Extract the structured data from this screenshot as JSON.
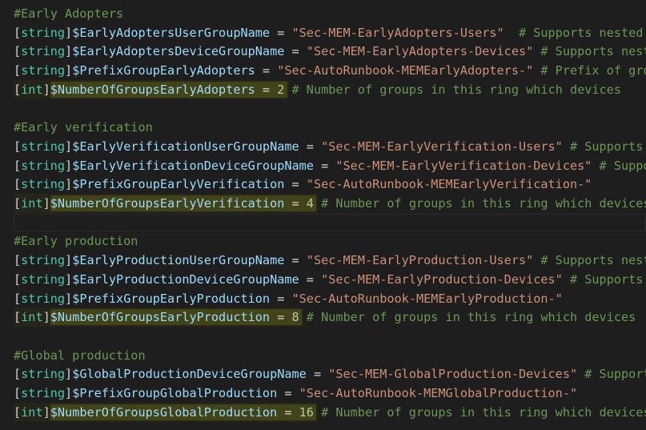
{
  "editor": {
    "colors": {
      "background": "#1e1e1e",
      "comment": "#6a9955",
      "type": "#4ec9b0",
      "variable": "#9cdcfe",
      "string": "#ce9178",
      "number": "#b5cea8"
    },
    "lines": [
      {
        "kind": "comment",
        "text": "#Early Adopters"
      },
      {
        "kind": "assign",
        "type": "string",
        "var": "$EarlyAdoptersUserGroupName",
        "op": " = ",
        "value": "\"Sec-MEM-EarlyAdopters-Users\"",
        "trail": "  # Supports nested groups"
      },
      {
        "kind": "assign",
        "type": "string",
        "var": "$EarlyAdoptersDeviceGroupName",
        "op": " = ",
        "value": "\"Sec-MEM-EarlyAdopters-Devices\"",
        "trail": " # Supports nested groups"
      },
      {
        "kind": "assign",
        "type": "string",
        "var": "$PrefixGroupEarlyAdopters",
        "op": " = ",
        "value": "\"Sec-AutoRunbook-MEMEarlyAdopters-\"",
        "trail": " # Prefix of groups"
      },
      {
        "kind": "assign",
        "type": "int",
        "var": "$NumberOfGroupsEarlyAdopters",
        "op": " = ",
        "value": "2",
        "trail": " # Number of groups in this ring which devices",
        "highlight": true
      },
      {
        "kind": "blank",
        "text": ""
      },
      {
        "kind": "comment",
        "text": "#Early verification"
      },
      {
        "kind": "assign",
        "type": "string",
        "var": "$EarlyVerificationUserGroupName",
        "op": " = ",
        "value": "\"Sec-MEM-EarlyVerification-Users\"",
        "trail": " # Supports nested groups"
      },
      {
        "kind": "assign",
        "type": "string",
        "var": "$EarlyVerificationDeviceGroupName",
        "op": " = ",
        "value": "\"Sec-MEM-EarlyVerification-Devices\"",
        "trail": " # Supports nested groups"
      },
      {
        "kind": "assign",
        "type": "string",
        "var": "$PrefixGroupEarlyVerification",
        "op": " = ",
        "value": "\"Sec-AutoRunbook-MEMEarlyVerification-\"",
        "trail": ""
      },
      {
        "kind": "assign",
        "type": "int",
        "var": "$NumberOfGroupsEarlyVerification",
        "op": " = ",
        "value": "4",
        "trail": " # Number of groups in this ring which devices",
        "highlight": true
      },
      {
        "kind": "blank",
        "text": "",
        "current": true
      },
      {
        "kind": "comment",
        "text": "#Early production"
      },
      {
        "kind": "assign",
        "type": "string",
        "var": "$EarlyProductionUserGroupName",
        "op": " = ",
        "value": "\"Sec-MEM-EarlyProduction-Users\"",
        "trail": " # Supports nested groups"
      },
      {
        "kind": "assign",
        "type": "string",
        "var": "$EarlyProductionDeviceGroupName",
        "op": " = ",
        "value": "\"Sec-MEM-EarlyProduction-Devices\"",
        "trail": " # Supports nested groups"
      },
      {
        "kind": "assign",
        "type": "string",
        "var": "$PrefixGroupEarlyProduction",
        "op": " = ",
        "value": "\"Sec-AutoRunbook-MEMEarlyProduction-\"",
        "trail": ""
      },
      {
        "kind": "assign",
        "type": "int",
        "var": "$NumberOfGroupsEarlyProduction",
        "op": " = ",
        "value": "8",
        "trail": " # Number of groups in this ring which devices",
        "highlight": true
      },
      {
        "kind": "blank",
        "text": ""
      },
      {
        "kind": "comment",
        "text": "#Global production"
      },
      {
        "kind": "assign",
        "type": "string",
        "var": "$GlobalProductionDeviceGroupName",
        "op": " = ",
        "value": "\"Sec-MEM-GlobalProduction-Devices\"",
        "trail": " # Supports nested groups"
      },
      {
        "kind": "assign",
        "type": "string",
        "var": "$PrefixGroupGlobalProduction",
        "op": " = ",
        "value": "\"Sec-AutoRunbook-MEMGlobalProduction-\"",
        "trail": ""
      },
      {
        "kind": "assign",
        "type": "int",
        "var": "$NumberOfGroupsGlobalProduction",
        "op": " = ",
        "value": "16",
        "trail": " # Number of groups in this ring which devices",
        "highlight": true
      }
    ]
  }
}
